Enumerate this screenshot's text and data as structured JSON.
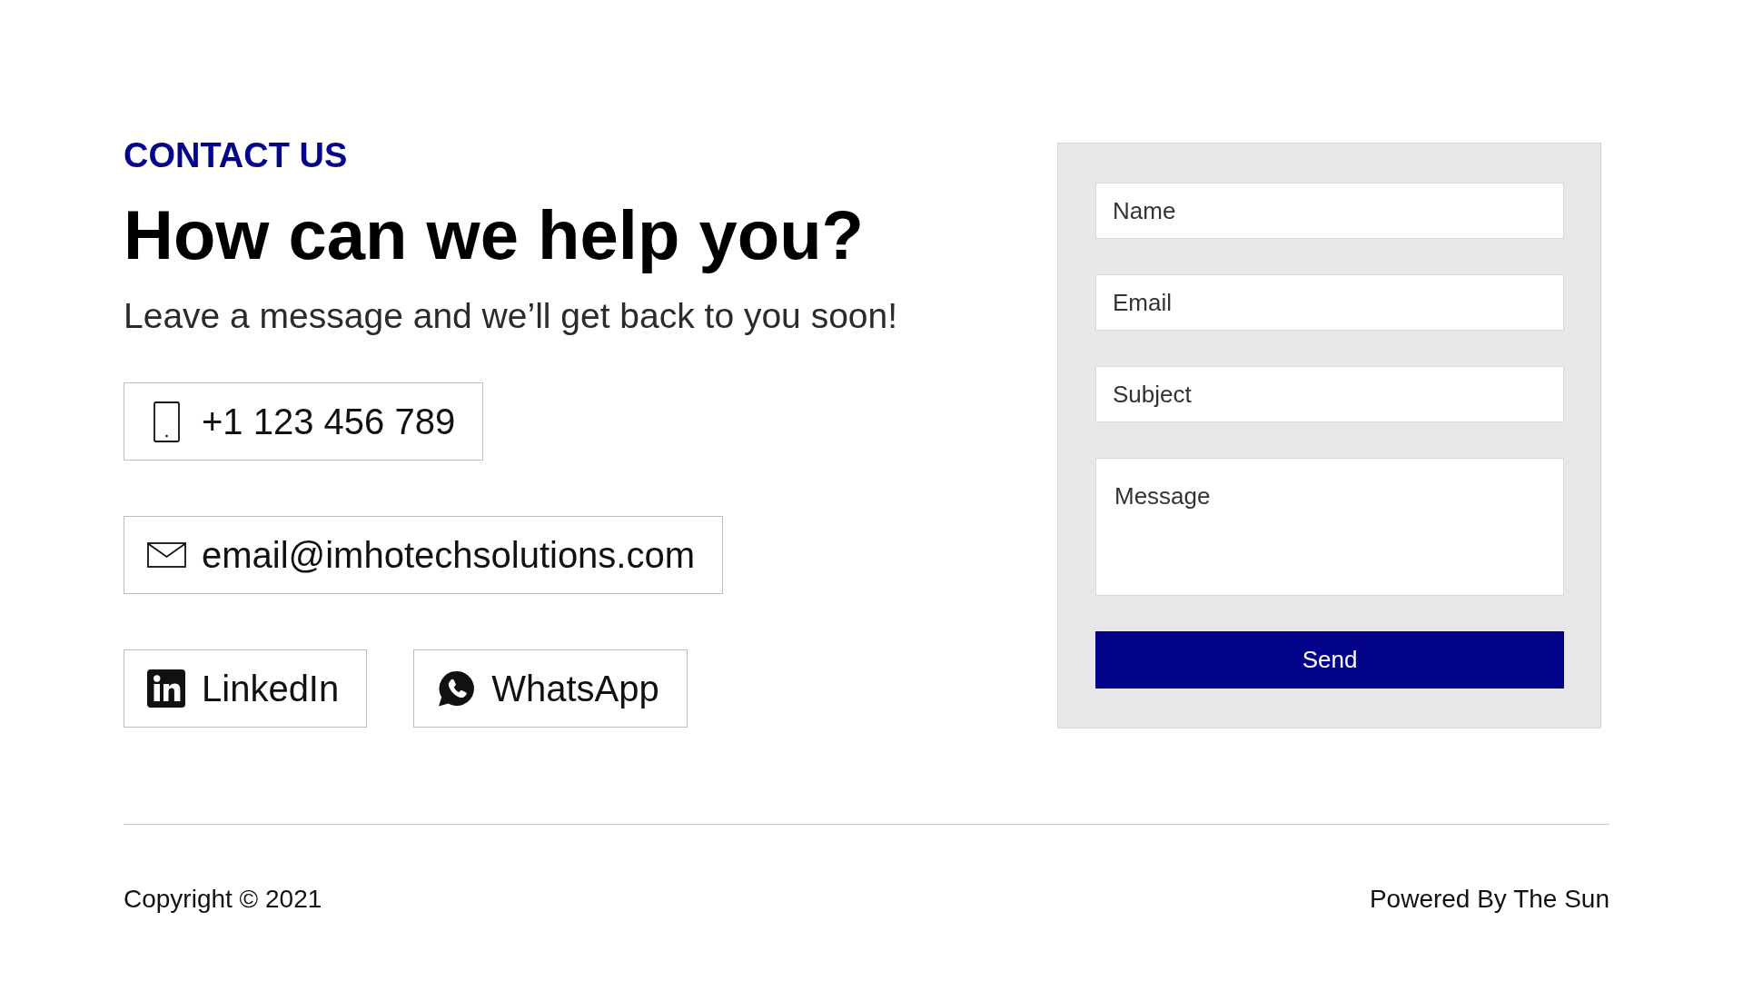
{
  "header": {
    "eyebrow": "CONTACT US",
    "title": "How can we help you?",
    "subtitle": "Leave a message and we’ll get back to you soon!"
  },
  "contacts": [
    {
      "kind": "phone",
      "label": "+1 123 456 789"
    },
    {
      "kind": "email",
      "label": "email@imhotechsolutions.com"
    }
  ],
  "socials": [
    {
      "kind": "linkedin",
      "label": "LinkedIn"
    },
    {
      "kind": "whatsapp",
      "label": "WhatsApp"
    }
  ],
  "form": {
    "fields": [
      {
        "kind": "text",
        "placeholder": "Name"
      },
      {
        "kind": "text",
        "placeholder": "Email"
      },
      {
        "kind": "text",
        "placeholder": "Subject"
      },
      {
        "kind": "textarea",
        "placeholder": "Message"
      }
    ],
    "submit": "Send"
  },
  "footer": {
    "copyright": "Copyright © 2021",
    "credit": "Powered By The Sun"
  }
}
